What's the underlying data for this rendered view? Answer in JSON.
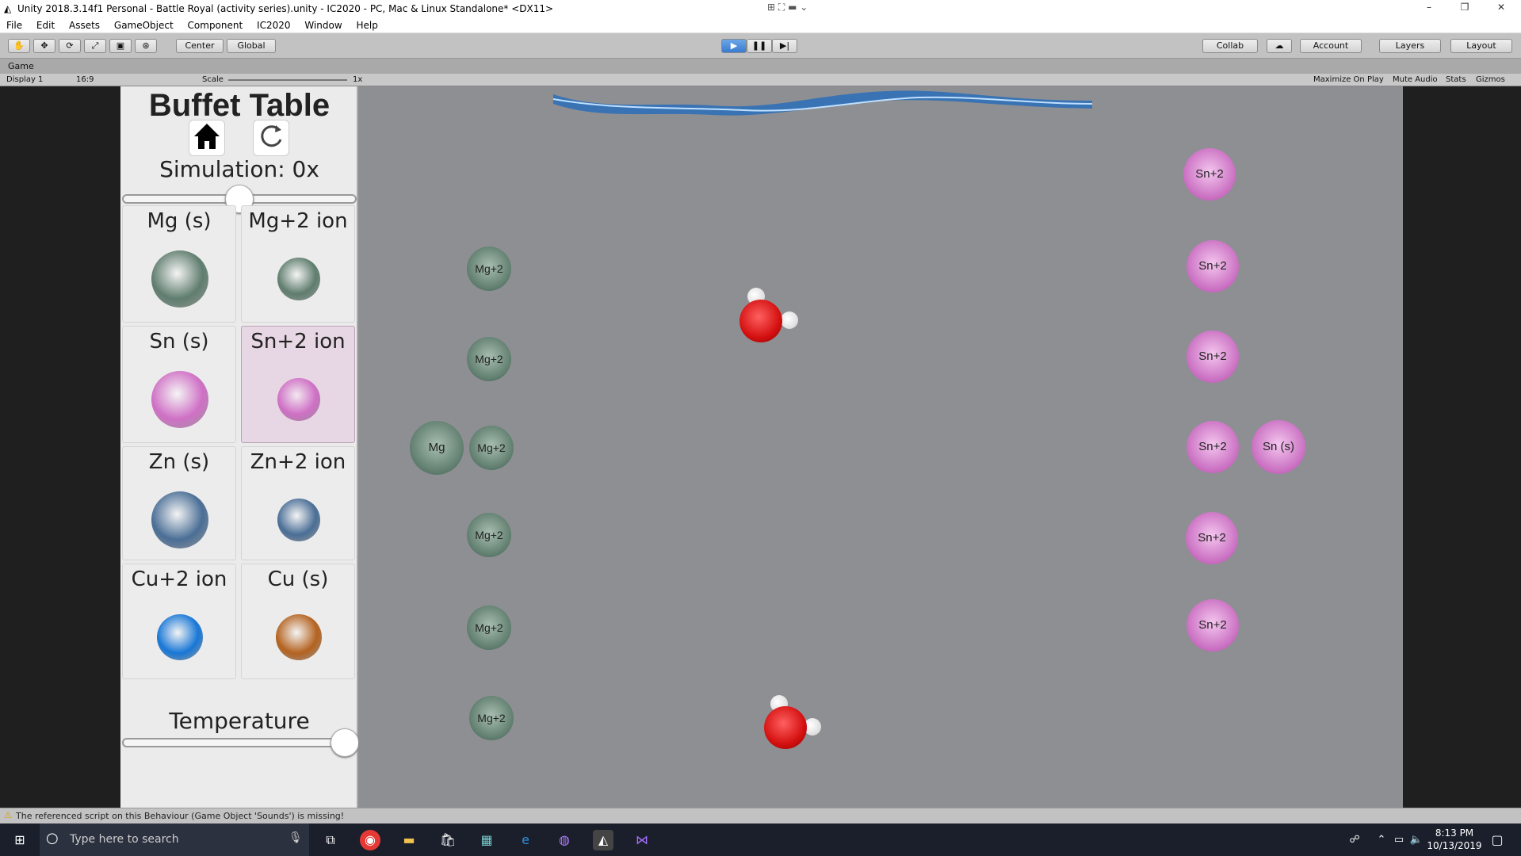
{
  "window": {
    "title": "Unity 2018.3.14f1 Personal - Battle Royal (activity series).unity - IC2020 - PC, Mac & Linux Standalone* <DX11>",
    "minimize": "–",
    "restore": "❐",
    "close": "✕"
  },
  "menu": [
    "File",
    "Edit",
    "Assets",
    "GameObject",
    "Component",
    "IC2020",
    "Window",
    "Help"
  ],
  "toolbar": {
    "center": "Center",
    "global": "Global",
    "collab": "Collab",
    "account": "Account",
    "layers": "Layers",
    "layout": "Layout"
  },
  "game": {
    "tab": "Game",
    "display": "Display 1",
    "aspect": "16:9",
    "scale_label": "Scale",
    "scale_value": "1x",
    "maximize": "Maximize On Play",
    "mute": "Mute Audio",
    "stats": "Stats",
    "gizmos": "Gizmos"
  },
  "panel": {
    "title": "Buffet Table",
    "simulation": "Simulation: 0x",
    "temperature": "Temperature",
    "simulation_level": 0.5,
    "temperature_level": 0.95,
    "items": [
      {
        "label": "Mg (s)",
        "color": "#5f7d6e",
        "selected": false
      },
      {
        "label": "Mg+2 ion",
        "color": "#5f7d6e",
        "selected": false
      },
      {
        "label": "Sn (s)",
        "color": "#cf70c5",
        "selected": false
      },
      {
        "label": "Sn+2 ion",
        "color": "#cf70c5",
        "selected": true
      },
      {
        "label": "Zn (s)",
        "color": "#4a6e96",
        "selected": false
      },
      {
        "label": "Zn+2 ion",
        "color": "#4a6e96",
        "selected": false
      },
      {
        "label": "Cu+2 ion",
        "color": "#1877d6",
        "selected": false
      },
      {
        "label": "Cu (s)",
        "color": "#b4621f",
        "selected": false
      }
    ]
  },
  "scene": {
    "mg_ion_label": "Mg+2",
    "mg_solid_label": "Mg",
    "sn_ion_label": "Sn+2",
    "sn_solid_label": "Sn (s)"
  },
  "status": "The referenced script on this Behaviour (Game Object 'Sounds') is missing!",
  "taskbar": {
    "search_placeholder": "Type here to search",
    "time": "8:13 PM",
    "date": "10/13/2019"
  }
}
